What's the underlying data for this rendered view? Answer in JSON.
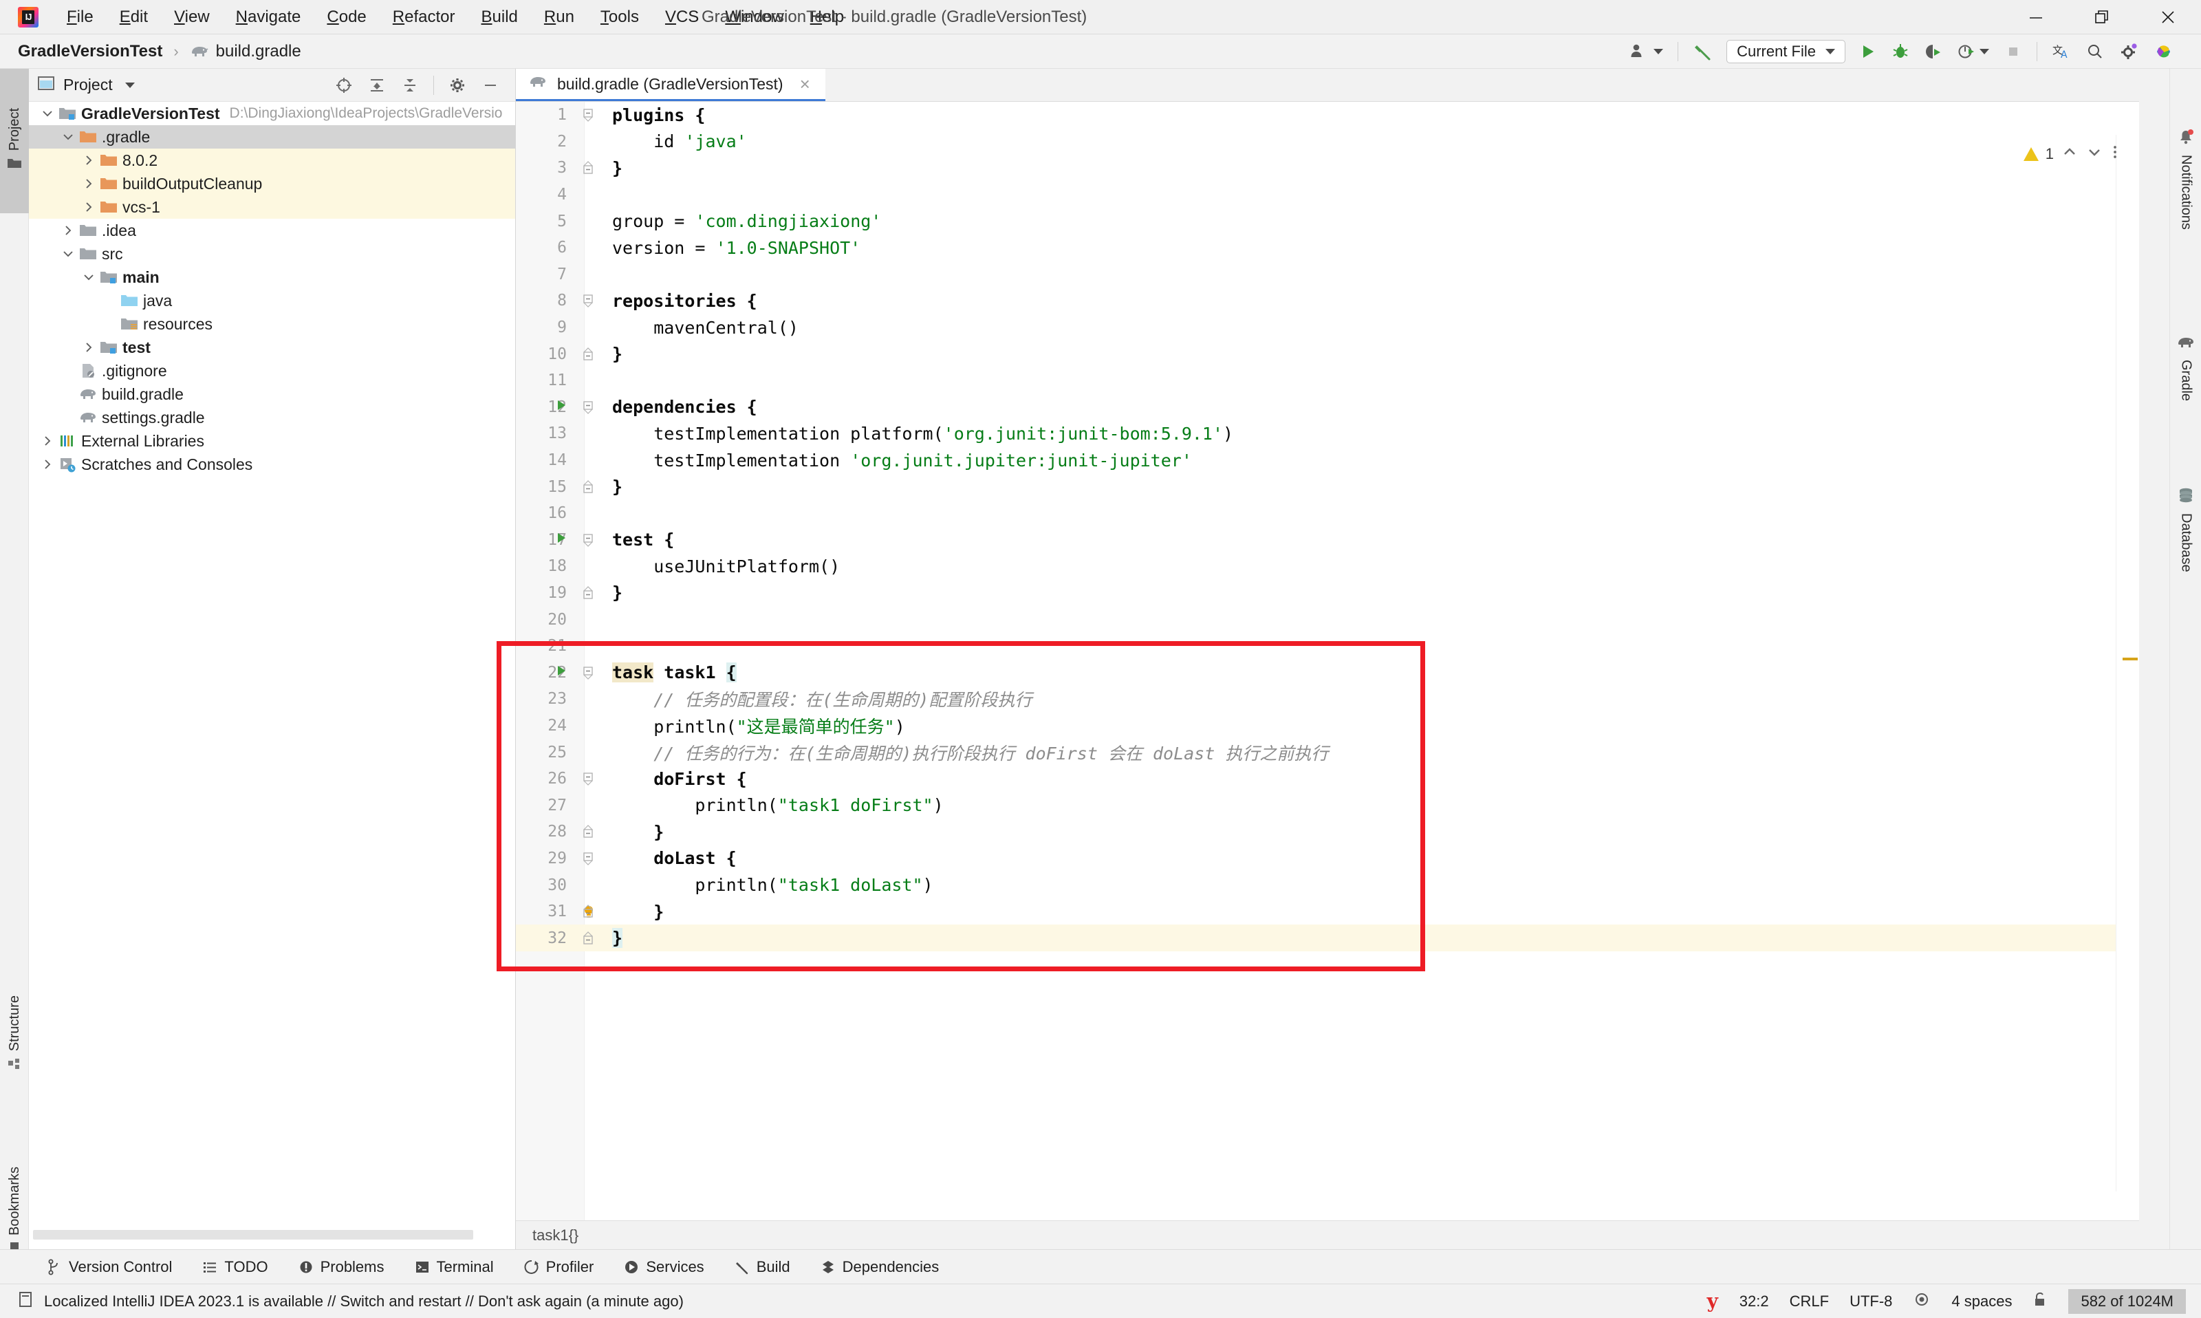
{
  "window": {
    "title": "GradleVersionTest - build.gradle (GradleVersionTest)",
    "minimize_label": "minimize-window",
    "restore_label": "restore-window",
    "close_label": "close-window"
  },
  "menubar": {
    "items": [
      {
        "label": "File",
        "acc": "F",
        "rest": "ile"
      },
      {
        "label": "Edit",
        "acc": "E",
        "rest": "dit"
      },
      {
        "label": "View",
        "acc": "V",
        "rest": "iew"
      },
      {
        "label": "Navigate",
        "acc": "N",
        "rest": "avigate"
      },
      {
        "label": "Code",
        "acc": "C",
        "rest": "ode"
      },
      {
        "label": "Refactor",
        "acc": "R",
        "rest": "efactor"
      },
      {
        "label": "Build",
        "acc": "B",
        "rest": "uild"
      },
      {
        "label": "Run",
        "acc": "R",
        "rest": "un"
      },
      {
        "label": "Tools",
        "acc": "T",
        "rest": "ools"
      },
      {
        "label": "VCS",
        "acc": "V",
        "rest": "CS"
      },
      {
        "label": "Window",
        "acc": "W",
        "rest": "indow"
      },
      {
        "label": "Help",
        "acc": "H",
        "rest": "elp"
      }
    ]
  },
  "navbar": {
    "project_name": "GradleVersionTest",
    "separator": "›",
    "file_name": "build.gradle",
    "run_config": "Current File"
  },
  "left_strip": {
    "project_tab": "Project",
    "structure_tab": "Structure",
    "bookmarks_tab": "Bookmarks"
  },
  "right_strip": {
    "notifications_tab": "Notifications",
    "gradle_tab": "Gradle",
    "database_tab": "Database"
  },
  "project_panel": {
    "title": "Project",
    "tree": [
      {
        "indent": 0,
        "arrow": "v",
        "icon": "module-folder",
        "label": "GradleVersionTest",
        "bold": true,
        "path": "D:\\DingJiaxiong\\IdeaProjects\\GradleVersio",
        "state": "normal"
      },
      {
        "indent": 1,
        "arrow": "v",
        "icon": "orange-folder",
        "label": ".gradle",
        "bold": false,
        "path": "",
        "state": "selected"
      },
      {
        "indent": 2,
        "arrow": ">",
        "icon": "orange-folder",
        "label": "8.0.2",
        "bold": false,
        "path": "",
        "state": "highlight"
      },
      {
        "indent": 2,
        "arrow": ">",
        "icon": "orange-folder",
        "label": "buildOutputCleanup",
        "bold": false,
        "path": "",
        "state": "highlight"
      },
      {
        "indent": 2,
        "arrow": ">",
        "icon": "orange-folder",
        "label": "vcs-1",
        "bold": false,
        "path": "",
        "state": "highlight"
      },
      {
        "indent": 1,
        "arrow": ">",
        "icon": "gray-folder",
        "label": ".idea",
        "bold": false,
        "path": "",
        "state": "normal"
      },
      {
        "indent": 1,
        "arrow": "v",
        "icon": "gray-folder",
        "label": "src",
        "bold": false,
        "path": "",
        "state": "normal"
      },
      {
        "indent": 2,
        "arrow": "v",
        "icon": "module-folder",
        "label": "main",
        "bold": true,
        "path": "",
        "state": "normal"
      },
      {
        "indent": 3,
        "arrow": "",
        "icon": "blue-folder",
        "label": "java",
        "bold": false,
        "path": "",
        "state": "normal"
      },
      {
        "indent": 3,
        "arrow": "",
        "icon": "resource-folder",
        "label": "resources",
        "bold": false,
        "path": "",
        "state": "normal"
      },
      {
        "indent": 2,
        "arrow": ">",
        "icon": "module-folder",
        "label": "test",
        "bold": true,
        "path": "",
        "state": "normal"
      },
      {
        "indent": 1,
        "arrow": "",
        "icon": "gitignore-file",
        "label": ".gitignore",
        "bold": false,
        "path": "",
        "state": "normal"
      },
      {
        "indent": 1,
        "arrow": "",
        "icon": "gradle-file",
        "label": "build.gradle",
        "bold": false,
        "path": "",
        "state": "normal"
      },
      {
        "indent": 1,
        "arrow": "",
        "icon": "gradle-file",
        "label": "settings.gradle",
        "bold": false,
        "path": "",
        "state": "normal"
      },
      {
        "indent": 0,
        "arrow": ">",
        "icon": "libraries",
        "label": "External Libraries",
        "bold": false,
        "path": "",
        "state": "normal"
      },
      {
        "indent": 0,
        "arrow": ">",
        "icon": "scratches",
        "label": "Scratches and Consoles",
        "bold": false,
        "path": "",
        "state": "normal"
      }
    ]
  },
  "editor": {
    "tab_label": "build.gradle (GradleVersionTest)",
    "close_glyph": "×",
    "breadcrumb": "task1{}",
    "inspection_count": "1",
    "lines": [
      {
        "n": "1",
        "indent": 0,
        "fold": "minus-top",
        "run": false,
        "bulb": false,
        "cur": false,
        "tokens": [
          {
            "t": "plugins ",
            "c": "kw"
          },
          {
            "t": "{",
            "c": "kw"
          }
        ]
      },
      {
        "n": "2",
        "indent": 0,
        "fold": "",
        "run": false,
        "bulb": false,
        "cur": false,
        "tokens": [
          {
            "t": "    id ",
            "c": ""
          },
          {
            "t": "'java'",
            "c": "str"
          }
        ]
      },
      {
        "n": "3",
        "indent": 0,
        "fold": "minus-bottom",
        "run": false,
        "bulb": false,
        "cur": false,
        "tokens": [
          {
            "t": "}",
            "c": "kw"
          }
        ]
      },
      {
        "n": "4",
        "indent": 0,
        "fold": "",
        "run": false,
        "bulb": false,
        "cur": false,
        "tokens": []
      },
      {
        "n": "5",
        "indent": 0,
        "fold": "",
        "run": false,
        "bulb": false,
        "cur": false,
        "tokens": [
          {
            "t": "group = ",
            "c": ""
          },
          {
            "t": "'com.dingjiaxiong'",
            "c": "str"
          }
        ]
      },
      {
        "n": "6",
        "indent": 0,
        "fold": "",
        "run": false,
        "bulb": false,
        "cur": false,
        "tokens": [
          {
            "t": "version = ",
            "c": ""
          },
          {
            "t": "'1.0-SNAPSHOT'",
            "c": "str"
          }
        ]
      },
      {
        "n": "7",
        "indent": 0,
        "fold": "",
        "run": false,
        "bulb": false,
        "cur": false,
        "tokens": []
      },
      {
        "n": "8",
        "indent": 0,
        "fold": "minus-top",
        "run": false,
        "bulb": false,
        "cur": false,
        "tokens": [
          {
            "t": "repositories ",
            "c": "kw"
          },
          {
            "t": "{",
            "c": "kw"
          }
        ]
      },
      {
        "n": "9",
        "indent": 0,
        "fold": "",
        "run": false,
        "bulb": false,
        "cur": false,
        "tokens": [
          {
            "t": "    mavenCentral()",
            "c": ""
          }
        ]
      },
      {
        "n": "10",
        "indent": 0,
        "fold": "minus-bottom",
        "run": false,
        "bulb": false,
        "cur": false,
        "tokens": [
          {
            "t": "}",
            "c": "kw"
          }
        ]
      },
      {
        "n": "11",
        "indent": 0,
        "fold": "",
        "run": false,
        "bulb": false,
        "cur": false,
        "tokens": []
      },
      {
        "n": "12",
        "indent": 0,
        "fold": "minus-top",
        "run": true,
        "bulb": false,
        "cur": false,
        "tokens": [
          {
            "t": "dependencies ",
            "c": "kw"
          },
          {
            "t": "{",
            "c": "kw"
          }
        ]
      },
      {
        "n": "13",
        "indent": 0,
        "fold": "",
        "run": false,
        "bulb": false,
        "cur": false,
        "tokens": [
          {
            "t": "    testImplementation platform(",
            "c": ""
          },
          {
            "t": "'org.junit:junit-bom:5.9.1'",
            "c": "str"
          },
          {
            "t": ")",
            "c": ""
          }
        ]
      },
      {
        "n": "14",
        "indent": 0,
        "fold": "",
        "run": false,
        "bulb": false,
        "cur": false,
        "tokens": [
          {
            "t": "    testImplementation ",
            "c": ""
          },
          {
            "t": "'org.junit.jupiter:junit-jupiter'",
            "c": "str"
          }
        ]
      },
      {
        "n": "15",
        "indent": 0,
        "fold": "minus-bottom",
        "run": false,
        "bulb": false,
        "cur": false,
        "tokens": [
          {
            "t": "}",
            "c": "kw"
          }
        ]
      },
      {
        "n": "16",
        "indent": 0,
        "fold": "",
        "run": false,
        "bulb": false,
        "cur": false,
        "tokens": []
      },
      {
        "n": "17",
        "indent": 0,
        "fold": "minus-top",
        "run": true,
        "bulb": false,
        "cur": false,
        "tokens": [
          {
            "t": "test ",
            "c": "kw"
          },
          {
            "t": "{",
            "c": "kw"
          }
        ]
      },
      {
        "n": "18",
        "indent": 0,
        "fold": "",
        "run": false,
        "bulb": false,
        "cur": false,
        "tokens": [
          {
            "t": "    useJUnitPlatform()",
            "c": ""
          }
        ]
      },
      {
        "n": "19",
        "indent": 0,
        "fold": "minus-bottom",
        "run": false,
        "bulb": false,
        "cur": false,
        "tokens": [
          {
            "t": "}",
            "c": "kw"
          }
        ]
      },
      {
        "n": "20",
        "indent": 0,
        "fold": "",
        "run": false,
        "bulb": false,
        "cur": false,
        "tokens": []
      },
      {
        "n": "21",
        "indent": 0,
        "fold": "",
        "run": false,
        "bulb": false,
        "cur": false,
        "tokens": []
      },
      {
        "n": "22",
        "indent": 0,
        "fold": "minus-top",
        "run": true,
        "bulb": false,
        "cur": false,
        "tokens": [
          {
            "t": "task",
            "c": "kw hi-word"
          },
          {
            "t": " task1 ",
            "c": "kw"
          },
          {
            "t": "{",
            "c": "kw hi-sym"
          }
        ]
      },
      {
        "n": "23",
        "indent": 0,
        "fold": "",
        "run": false,
        "bulb": false,
        "cur": false,
        "tokens": [
          {
            "t": "    // 任务的配置段：在(生命周期的)配置阶段执行",
            "c": "cmt"
          }
        ]
      },
      {
        "n": "24",
        "indent": 0,
        "fold": "",
        "run": false,
        "bulb": false,
        "cur": false,
        "tokens": [
          {
            "t": "    println(",
            "c": ""
          },
          {
            "t": "\"这是最简单的任务\"",
            "c": "str"
          },
          {
            "t": ")",
            "c": ""
          }
        ]
      },
      {
        "n": "25",
        "indent": 0,
        "fold": "",
        "run": false,
        "bulb": false,
        "cur": false,
        "tokens": [
          {
            "t": "    // 任务的行为：在(生命周期的)执行阶段执行 doFirst 会在 doLast 执行之前执行",
            "c": "cmt"
          }
        ]
      },
      {
        "n": "26",
        "indent": 0,
        "fold": "minus-top",
        "run": false,
        "bulb": false,
        "cur": false,
        "tokens": [
          {
            "t": "    doFirst {",
            "c": "kw"
          }
        ]
      },
      {
        "n": "27",
        "indent": 0,
        "fold": "",
        "run": false,
        "bulb": false,
        "cur": false,
        "tokens": [
          {
            "t": "        println(",
            "c": ""
          },
          {
            "t": "\"task1 doFirst\"",
            "c": "str"
          },
          {
            "t": ")",
            "c": ""
          }
        ]
      },
      {
        "n": "28",
        "indent": 0,
        "fold": "minus-bottom",
        "run": false,
        "bulb": false,
        "cur": false,
        "tokens": [
          {
            "t": "    }",
            "c": "kw"
          }
        ]
      },
      {
        "n": "29",
        "indent": 0,
        "fold": "minus-top",
        "run": false,
        "bulb": false,
        "cur": false,
        "tokens": [
          {
            "t": "    doLast {",
            "c": "kw"
          }
        ]
      },
      {
        "n": "30",
        "indent": 0,
        "fold": "",
        "run": false,
        "bulb": false,
        "cur": false,
        "tokens": [
          {
            "t": "        println(",
            "c": ""
          },
          {
            "t": "\"task1 doLast\"",
            "c": "str"
          },
          {
            "t": ")",
            "c": ""
          }
        ]
      },
      {
        "n": "31",
        "indent": 0,
        "fold": "minus-bottom",
        "run": false,
        "bulb": true,
        "cur": false,
        "tokens": [
          {
            "t": "    }",
            "c": "kw"
          }
        ]
      },
      {
        "n": "32",
        "indent": 0,
        "fold": "minus-bottom",
        "run": false,
        "bulb": false,
        "cur": true,
        "tokens": [
          {
            "t": "}",
            "c": "kw hi-sym"
          }
        ]
      }
    ]
  },
  "toolwindow_bar": {
    "items": [
      {
        "label": "Version Control",
        "icon": "branch-icon"
      },
      {
        "label": "TODO",
        "icon": "list-icon"
      },
      {
        "label": "Problems",
        "icon": "problems-icon"
      },
      {
        "label": "Terminal",
        "icon": "terminal-icon"
      },
      {
        "label": "Profiler",
        "icon": "profiler-icon"
      },
      {
        "label": "Services",
        "icon": "services-icon"
      },
      {
        "label": "Build",
        "icon": "hammer-icon"
      },
      {
        "label": "Dependencies",
        "icon": "dependencies-icon"
      }
    ]
  },
  "statusbar": {
    "message": "Localized IntelliJ IDEA 2023.1 is available // Switch and restart // Don't ask again (a minute ago)",
    "caret_position": "32:2",
    "line_separator": "CRLF",
    "encoding": "UTF-8",
    "indent": "4 spaces",
    "memory": "582 of 1024M"
  },
  "colors": {
    "accent_blue": "#3e7ad6",
    "string_green": "#067d17",
    "comment_gray": "#8c8c8c",
    "annotation_red": "#ee1c25",
    "warning_yellow": "#ecc31a",
    "folder_orange": "#e8975a"
  }
}
